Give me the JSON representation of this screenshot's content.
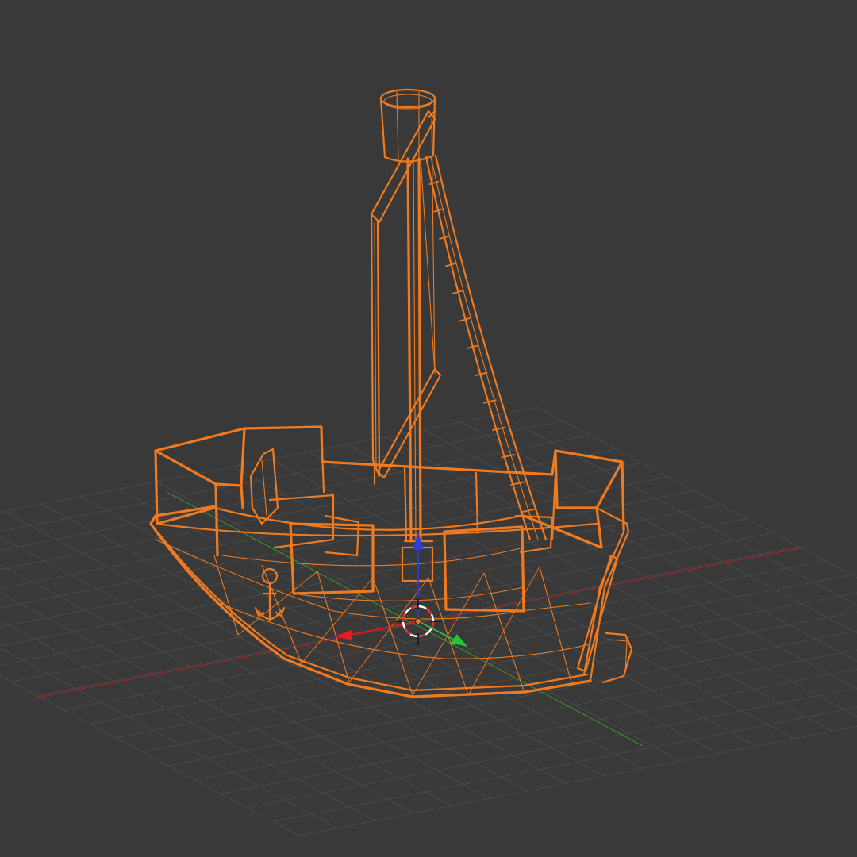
{
  "viewport": {
    "mode": "wireframe",
    "background_color": "#393939",
    "grid_color": "#4a4a4a",
    "x_axis_color": "#9b2a2a",
    "y_axis_color": "#3d8a2f",
    "selection_color": "#f07a20"
  },
  "object": {
    "name_icon": "ship-mesh",
    "selected": true,
    "parts": [
      "hull",
      "deck-rail",
      "mast",
      "crows-nest",
      "sail",
      "rope-ladder",
      "anchor",
      "rudder"
    ]
  },
  "gizmo": {
    "manipulator_icons": [
      "x-arrow-icon",
      "y-arrow-icon",
      "z-arrow-icon"
    ],
    "x_color": "#e02020",
    "y_color": "#27c43a",
    "z_color": "#2b3ee0",
    "cursor_icon": "3d-cursor-icon"
  }
}
